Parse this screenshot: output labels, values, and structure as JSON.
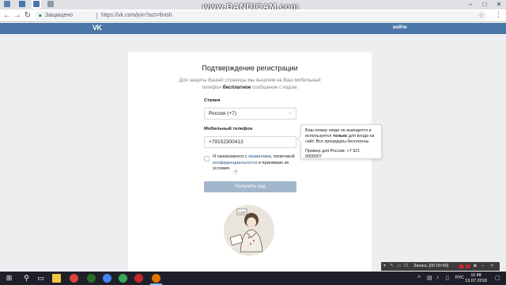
{
  "watermark": "www.BANDICAM.com",
  "browser": {
    "secure_label": "Защищено",
    "url": "https://vk.com/join?act=finish",
    "window_controls": [
      "–",
      "□",
      "✕"
    ]
  },
  "vk": {
    "logo": "VK",
    "login": "войти"
  },
  "form": {
    "title": "Подтверждение регистрации",
    "desc_pre": "Для защиты Вашей страницы мы вышлем на Ваш мобильный телефон ",
    "desc_bold": "бесплатное",
    "desc_post": " сообщение с кодом.",
    "country_label": "Страна",
    "country_value": "Россия (+7)",
    "phone_label": "Мобильный телефон",
    "phone_value": "+79152300413",
    "agree_pre": "Я ознакомился с ",
    "agree_link1": "правилами",
    "agree_mid": ", политикой ",
    "agree_link2": "конфиденциальности",
    "agree_post": " и принимаю их условия.",
    "submit": "Получить код"
  },
  "tooltip": {
    "line_pre": "Ваш номер нигде не выводится и используется ",
    "line_bold": "только",
    "line_post": " для входа на сайт. Все процедуры бесплатны.",
    "example": "Пример для России: +7 921 0000007"
  },
  "recorder": {
    "label": "Запись [00:00:49]"
  },
  "taskbar": {
    "lang": "РУС",
    "time": "11:48",
    "date": "13.07.2018"
  },
  "colors": {
    "vk_blue": "#4a76a8",
    "button_disabled": "#a2b6cc",
    "link": "#2a5885"
  }
}
